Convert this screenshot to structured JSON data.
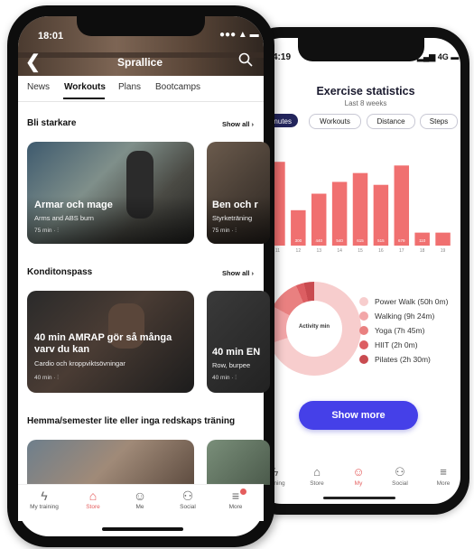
{
  "back_phone": {
    "status": {
      "time": "4:19",
      "network": "4G"
    },
    "title": "Exercise statistics",
    "subtitle": "Last 8 weeks",
    "filters": [
      {
        "label": "Minutes",
        "active": true
      },
      {
        "label": "Workouts",
        "active": false
      },
      {
        "label": "Distance",
        "active": false
      },
      {
        "label": "Steps",
        "active": false
      }
    ],
    "chart_data": {
      "type": "bar",
      "categories": [
        "11",
        "12",
        "13",
        "14",
        "15",
        "16",
        "17",
        "18",
        "19"
      ],
      "values": [
        710,
        300,
        440,
        540,
        615,
        515,
        679,
        110,
        110
      ],
      "value_labels": [
        "",
        "300",
        "440",
        "540",
        "615",
        "515",
        "679",
        "110",
        ""
      ],
      "ylim": [
        0,
        750
      ],
      "color": "#f07070"
    },
    "donut": {
      "center_label": "Activity min",
      "slices": [
        {
          "name": "Power Walk (50h 0m)",
          "value": 50,
          "color": "#f7cdcd"
        },
        {
          "name": "Walking (9h 24m)",
          "value": 9.4,
          "color": "#f2a6a8"
        },
        {
          "name": "Yoga (7h 45m)",
          "value": 7.75,
          "color": "#e98080"
        },
        {
          "name": "HIIT (2h 0m)",
          "value": 2,
          "color": "#dc5e62"
        },
        {
          "name": "Pilates (2h 30m)",
          "value": 2.5,
          "color": "#c94b50"
        }
      ]
    },
    "show_more": "Show more",
    "tabs": [
      {
        "label": "training",
        "icon": "lightning-icon"
      },
      {
        "label": "Store",
        "icon": "store-icon"
      },
      {
        "label": "My",
        "icon": "person-icon",
        "active": true
      },
      {
        "label": "Social",
        "icon": "people-icon"
      },
      {
        "label": "More",
        "icon": "menu-icon"
      }
    ]
  },
  "front_phone": {
    "status": {
      "time": "18:01",
      "icons": "●●● ▲ ▬"
    },
    "app_title": "Sprallice",
    "tabs": [
      {
        "label": "News",
        "active": false
      },
      {
        "label": "Workouts",
        "active": true
      },
      {
        "label": "Plans",
        "active": false
      },
      {
        "label": "Bootcamps",
        "active": false
      }
    ],
    "sections": [
      {
        "title": "Bli starkare",
        "show_all": "Show all",
        "cards": [
          {
            "title": "Armar och mage",
            "subtitle": "Arms and ABS burn",
            "meta": "75 min ·"
          },
          {
            "title": "Ben och r",
            "subtitle": "Styrketräning",
            "meta": "75 min ·"
          }
        ]
      },
      {
        "title": "Konditonspass",
        "show_all": "Show all",
        "cards": [
          {
            "title": "40 min AMRAP gör så många varv du kan",
            "subtitle": "Cardio och kroppviktsövningar",
            "meta": "40 min ·"
          },
          {
            "title": "40 min EN",
            "subtitle": "Row, burpee",
            "meta": "40 min ·"
          }
        ]
      },
      {
        "title": "Hemma/semester lite eller inga redskaps träning",
        "show_all": ""
      }
    ],
    "bottom_tabs": [
      {
        "label": "My training",
        "icon": "lightning-icon",
        "glyph": "ϟ",
        "active": false
      },
      {
        "label": "Store",
        "icon": "store-icon",
        "glyph": "⌂",
        "active": true
      },
      {
        "label": "Me",
        "icon": "person-icon",
        "glyph": "☺",
        "active": false
      },
      {
        "label": "Social",
        "icon": "people-icon",
        "glyph": "⚇",
        "active": false
      },
      {
        "label": "More",
        "icon": "menu-icon",
        "glyph": "≡",
        "active": false
      }
    ],
    "colors": {
      "accent": "#e45d5d",
      "button": "#4540e8"
    }
  }
}
